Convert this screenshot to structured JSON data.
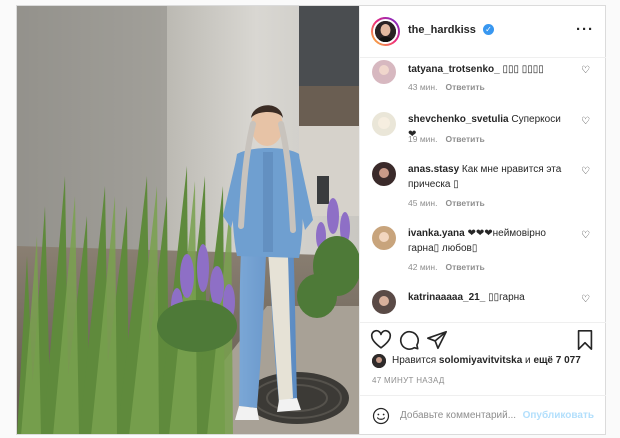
{
  "post": {
    "username": "the_hardkiss",
    "verified_glyph": "✓",
    "more_glyph": "···",
    "photo_alt_icon": "post-photo"
  },
  "comments": [
    {
      "user": "tatyana_trotsenko_",
      "text": " ▯▯▯ ▯▯▯▯",
      "age": "43 мин.",
      "reply": "Ответить"
    },
    {
      "user": "shevchenko_svetulia",
      "text": " Суперкоси❤",
      "age": "19 мин.",
      "reply": "Ответить"
    },
    {
      "user": "anas.stasy",
      "text": " Как мне нравится эта прическа ▯",
      "age": "45 мин.",
      "reply": "Ответить"
    },
    {
      "user": "ivanka.yana",
      "text": " ❤❤❤неймовірно гарна▯ любов▯",
      "age": "42 мин.",
      "reply": "Ответить"
    },
    {
      "user": "katrinaaaaa_21_",
      "text": " ▯▯гарна",
      "age": "",
      "reply": ""
    }
  ],
  "actions": {
    "like_icon": "heart-icon",
    "comment_icon": "comment-icon",
    "share_icon": "paper-plane-icon",
    "save_icon": "bookmark-icon"
  },
  "likes": {
    "prefix": "Нравится ",
    "user": "solomiyavitvitska",
    "middle": " и ",
    "count": "ещё 7 077"
  },
  "timestamp": "47 МИНУТ НАЗАД",
  "add_comment": {
    "placeholder": "Добавьте комментарий...",
    "post_label": "Опубликовать"
  },
  "colors": {
    "accent": "#3897f0",
    "post_disabled": "#b2dffc",
    "muted": "#8e8e8e"
  }
}
